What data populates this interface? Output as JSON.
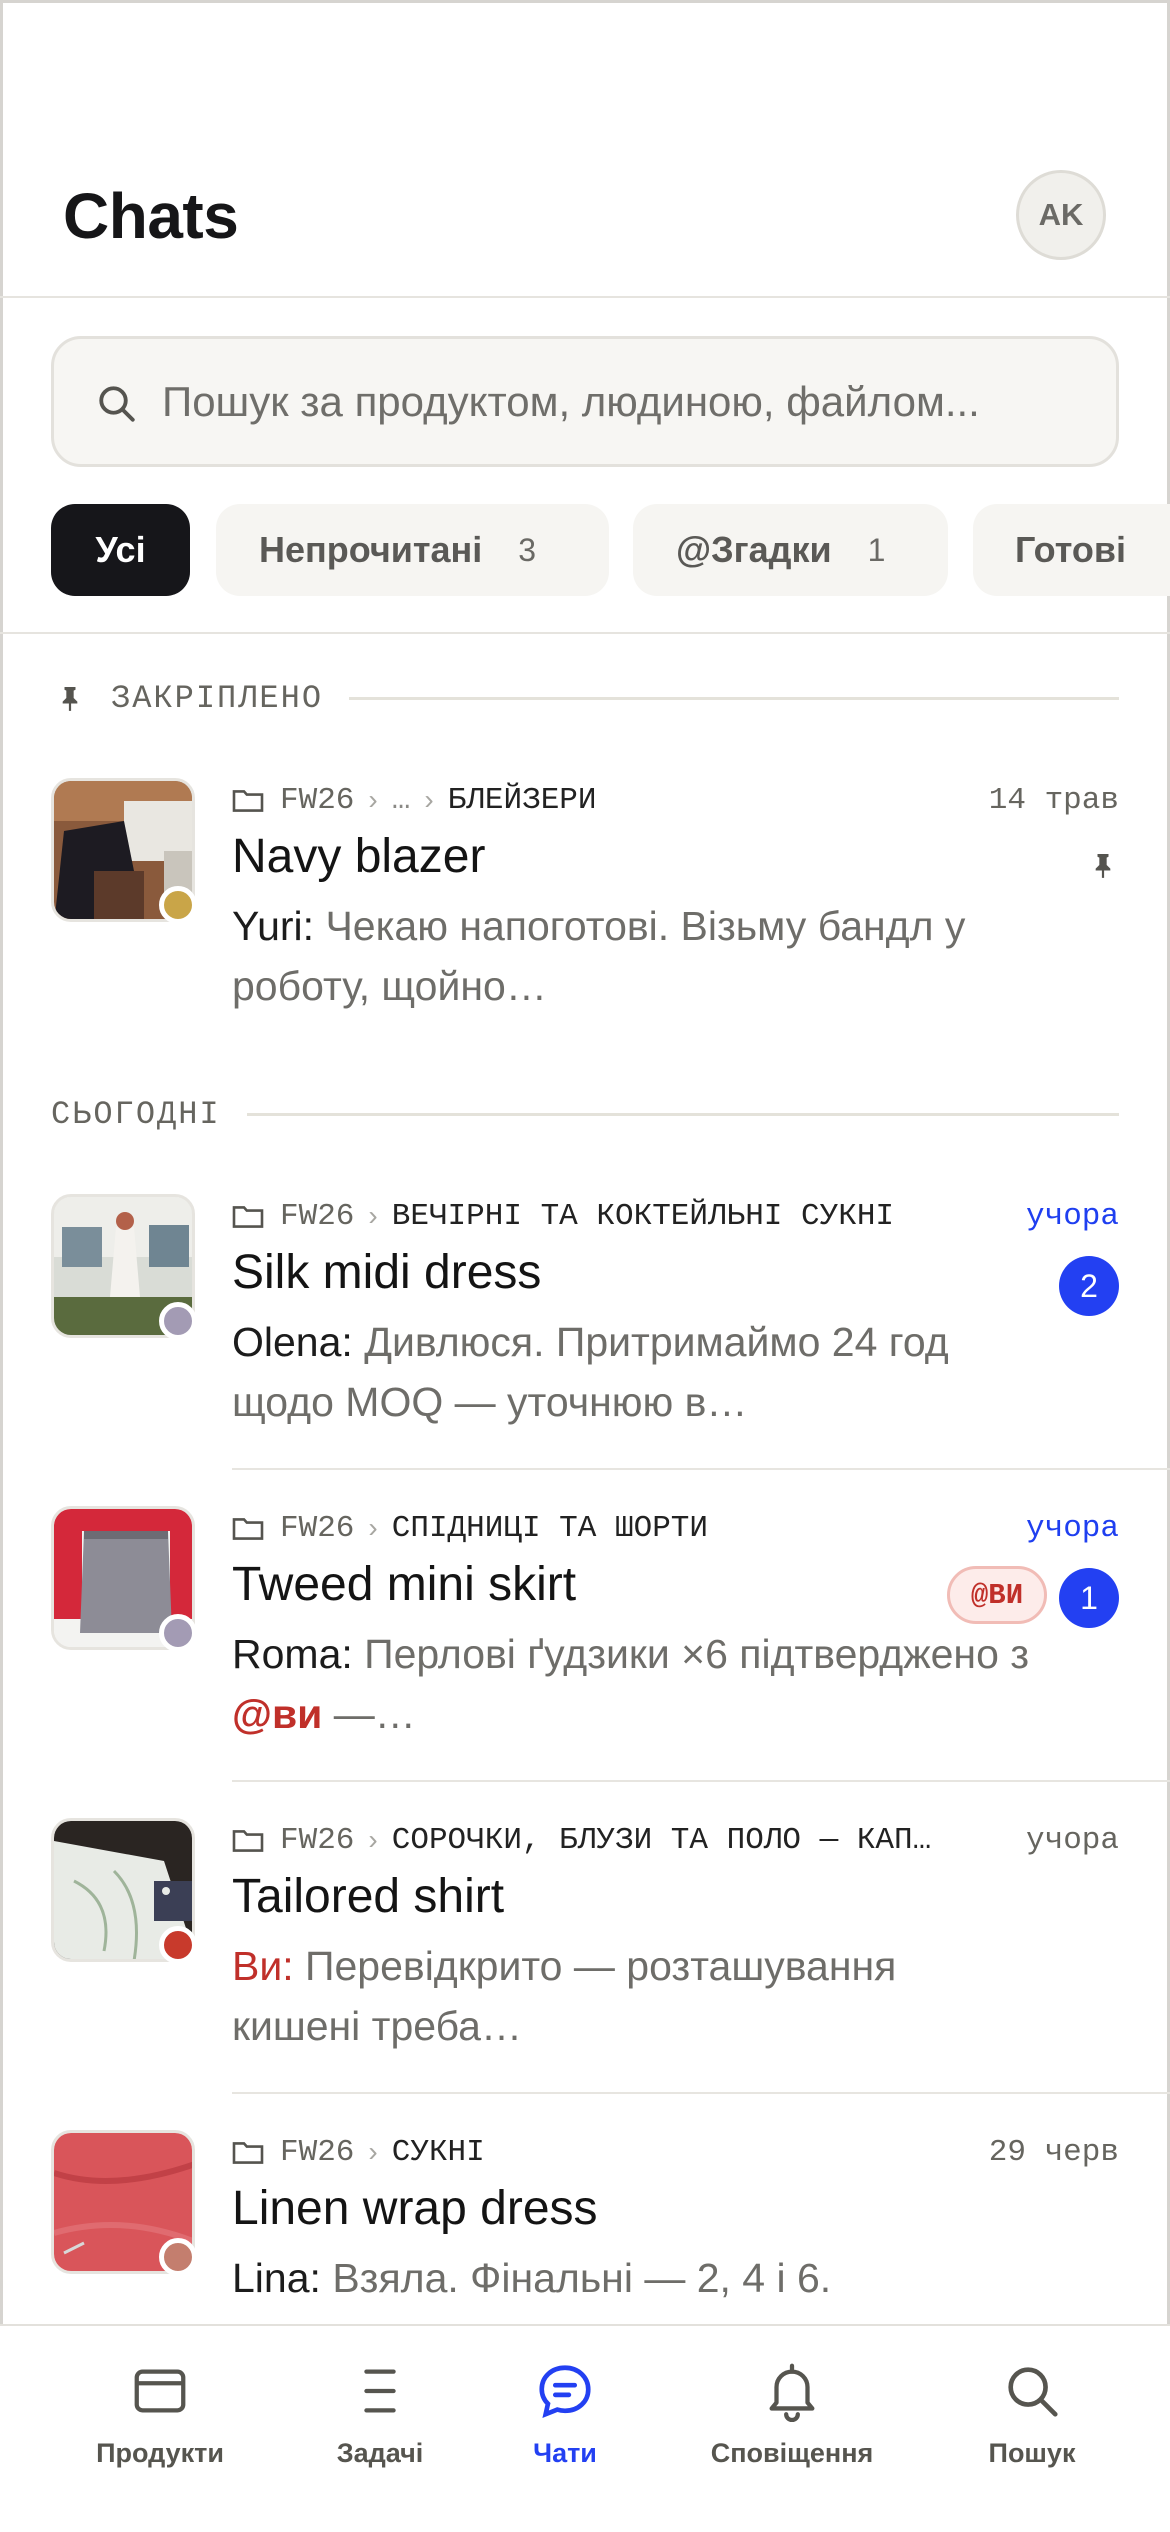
{
  "header": {
    "title": "Chats",
    "avatar_initials": "AK"
  },
  "search": {
    "placeholder": "Пошук за продуктом, людиною, файлом..."
  },
  "filters": [
    {
      "label": "Усі",
      "count": ""
    },
    {
      "label": "Непрочитані",
      "count": "3"
    },
    {
      "label": "@Згадки",
      "count": "1"
    },
    {
      "label": "Готові",
      "count": ""
    }
  ],
  "sections": {
    "pinned": "ЗАКРІПЛЕНО",
    "today": "СЬОГОДНІ"
  },
  "chats": [
    {
      "project": "FW26",
      "path_ellipsis": "…",
      "category": "БЛЕЙЗЕРИ",
      "time": "14 трав",
      "title": "Navy blazer",
      "author": "Yuri:",
      "preview": " Чекаю напоготові. Візьму бандл у роботу, щойно…",
      "pinned": true,
      "status_color": "#c9a548"
    },
    {
      "project": "FW26",
      "category": "ВЕЧІРНІ ТА КОКТЕЙЛЬНІ СУКНІ",
      "time": "учора",
      "title": "Silk midi dress",
      "author": "Olena:",
      "preview": " Дивлюся. Притримаймо 24 год щодо MOQ — уточнюю в…",
      "unread": "2",
      "status_color": "#a39bb4"
    },
    {
      "project": "FW26",
      "category": "СПІДНИЦІ ТА ШОРТИ",
      "time": "учора",
      "title": "Tweed mini skirt",
      "author": "Roma:",
      "preview_before": " Перлові ґудзики ×6 підтверджено з ",
      "mention": "@ви",
      "preview_after": " —…",
      "mention_badge": "@ВИ",
      "unread": "1",
      "status_color": "#a39bb4"
    },
    {
      "project": "FW26",
      "category": "СОРОЧКИ, БЛУЗИ ТА ПОЛО — КАП…",
      "time": "учора",
      "title": "Tailored shirt",
      "author": "Ви:",
      "preview": " Перевідкрито — розташування кишені треба…",
      "status_color": "#c83a2c"
    },
    {
      "project": "FW26",
      "category": "СУКНІ",
      "time": "29 черв",
      "title": "Linen wrap dress",
      "author": "Lina:",
      "preview": " Взяла. Фінальні — 2, 4 і 6.",
      "status_color": "#c47e6e"
    }
  ],
  "nav": [
    {
      "label": "Продукти",
      "icon": "products-icon"
    },
    {
      "label": "Задачі",
      "icon": "tasks-icon"
    },
    {
      "label": "Чати",
      "icon": "chat-icon",
      "active": true
    },
    {
      "label": "Сповіщення",
      "icon": "bell-icon"
    },
    {
      "label": "Пошук",
      "icon": "search-icon"
    }
  ]
}
